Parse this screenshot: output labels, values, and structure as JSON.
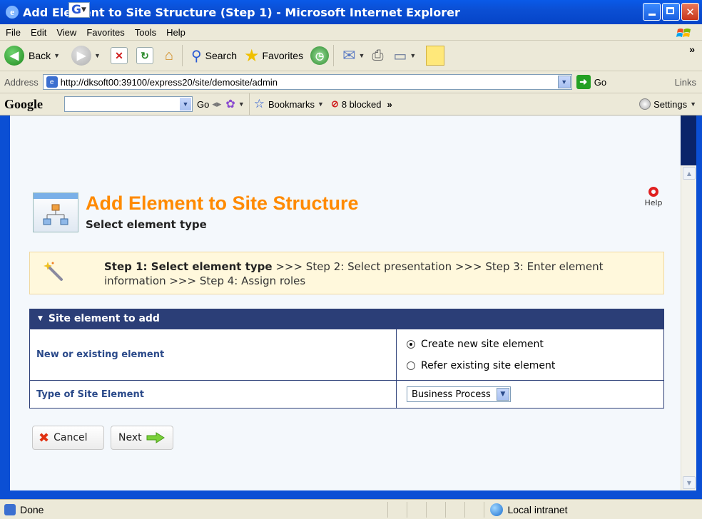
{
  "window": {
    "title": "Add Element to Site Structure (Step 1) - Microsoft Internet Explorer"
  },
  "menu": {
    "items": [
      "File",
      "Edit",
      "View",
      "Favorites",
      "Tools",
      "Help"
    ]
  },
  "toolbar": {
    "back_label": "Back",
    "search_label": "Search",
    "favorites_label": "Favorites"
  },
  "address": {
    "label": "Address",
    "url": "http://dksoft00:39100/express20/site/demosite/admin",
    "go_label": "Go",
    "links_label": "Links"
  },
  "google_bar": {
    "logo": "Google",
    "go_label": "Go",
    "bookmarks_label": "Bookmarks",
    "blocked_label": "8 blocked",
    "more_label": "»",
    "settings_label": "Settings"
  },
  "page": {
    "title": "Add Element to Site Structure",
    "subtitle": "Select element type",
    "help_label": "Help",
    "steps": {
      "current": "Step 1: Select element type",
      "rest": " >>> Step 2: Select presentation >>> Step 3: Enter element information >>> Step 4: Assign roles"
    },
    "panel": {
      "heading": "Site element to add",
      "rows": [
        {
          "label": "New or existing element",
          "options": [
            "Create new site element",
            "Refer existing site element"
          ],
          "selected": 0
        },
        {
          "label": "Type of Site Element",
          "select_value": "Business Process"
        }
      ]
    },
    "buttons": {
      "cancel": "Cancel",
      "next": "Next"
    }
  },
  "status": {
    "text": "Done",
    "zone": "Local intranet"
  }
}
